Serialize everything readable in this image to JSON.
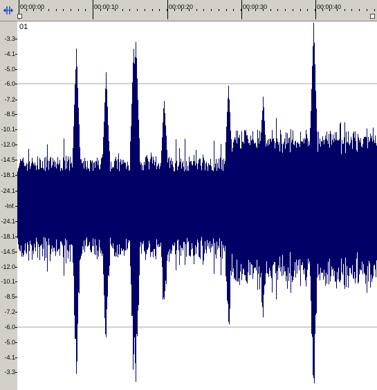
{
  "ruler": {
    "time_labels": [
      "00:00:00",
      "00:00:10",
      "00:00:20",
      "00:00:30",
      "00:00:40"
    ],
    "zoom_icon": "zoom-tool-icon",
    "flag_icons": [
      "start-marker-icon",
      "end-marker-icon"
    ]
  },
  "scale": {
    "labels": [
      "-3.3",
      "-4.1",
      "-5.0",
      "-6.0",
      "-7.2",
      "-8.5",
      "-10.1",
      "-12.0",
      "-14.5",
      "-18.1",
      "-24.1",
      "-Inf.",
      "-24.1",
      "-18.1",
      "-14.5",
      "-12.0",
      "-10.1",
      "-8.5",
      "-7.2",
      "-6.0",
      "-5.0",
      "-4.1",
      "-3.3"
    ]
  },
  "track": {
    "label": "01",
    "waveform_color": "#000066",
    "background_color": "#ffffff",
    "gridline_color": "#a0a0a0"
  }
}
